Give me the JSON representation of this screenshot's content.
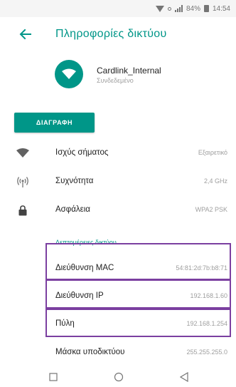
{
  "status_bar": {
    "battery": "84%",
    "time": "14:54"
  },
  "app_bar": {
    "back_icon": "arrow-back-icon",
    "title": "Πληροφορίες δικτύου"
  },
  "network": {
    "icon": "wifi-icon",
    "name": "Cardlink_Internal",
    "status": "Συνδεδεμένο"
  },
  "delete_button": {
    "label": "ΔΙΑΓΡΑΦΗ"
  },
  "info_rows": [
    {
      "icon": "signal-strength-icon",
      "label": "Ισχύς σήματος",
      "value": "Εξαιρετικό"
    },
    {
      "icon": "frequency-icon",
      "label": "Συχνότητα",
      "value": "2,4 GHz"
    },
    {
      "icon": "lock-icon",
      "label": "Ασφάλεια",
      "value": "WPA2 PSK"
    }
  ],
  "advanced": {
    "section_title": "Λεπτομέρειες δικτύου",
    "rows": [
      {
        "label": "Διεύθυνση MAC",
        "value": "54:81:2d:7b:b8:71"
      },
      {
        "label": "Διεύθυνση IP",
        "value": "192.168.1.60"
      },
      {
        "label": "Πύλη",
        "value": "192.168.1.254"
      },
      {
        "label": "Μάσκα υποδικτύου",
        "value": "255.255.255.0"
      }
    ]
  },
  "colors": {
    "accent": "#009688",
    "highlight": "#7b3fa0"
  },
  "navigation_bar": [
    "recents-icon",
    "home-icon",
    "back-triangle-icon"
  ]
}
